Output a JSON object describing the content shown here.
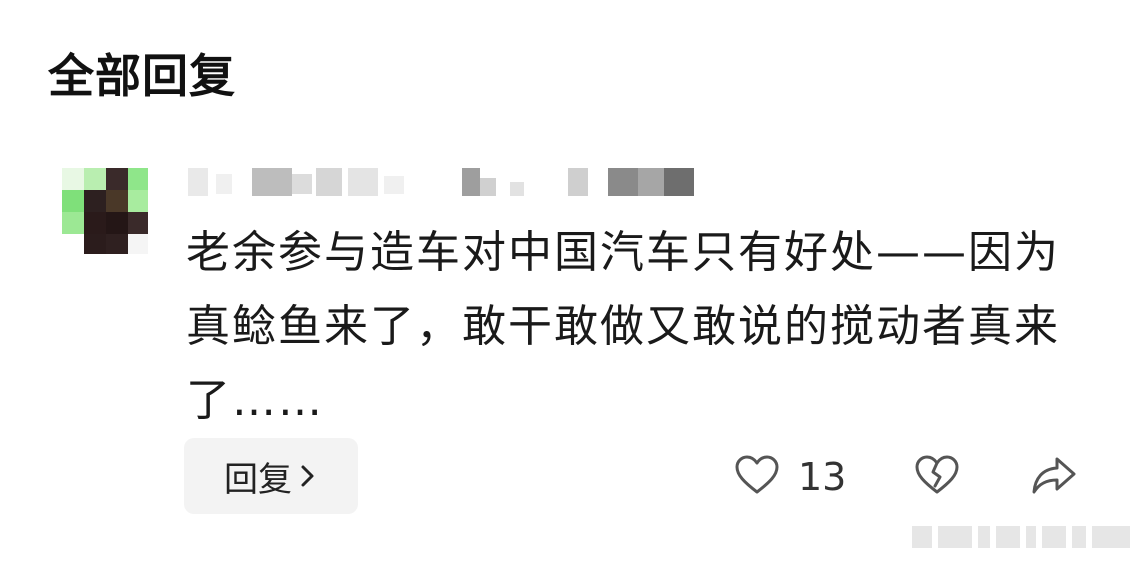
{
  "section": {
    "title": "全部回复"
  },
  "comment": {
    "text": "老余参与造车对中国汽车只有好处——因为真鲶鱼来了，敢干敢做又敢说的搅动者真来了……",
    "reply_label": "回复",
    "like_count": "13"
  },
  "icons": {
    "avatar": "pixelated-avatar",
    "reply_chevron": "chevron-right-icon",
    "like": "heart-icon",
    "dislike": "broken-heart-icon",
    "share": "share-arrow-icon"
  },
  "colors": {
    "background": "#ffffff",
    "text": "#1a1a1a",
    "reply_button_bg": "#f3f3f3",
    "icon": "#555555"
  }
}
